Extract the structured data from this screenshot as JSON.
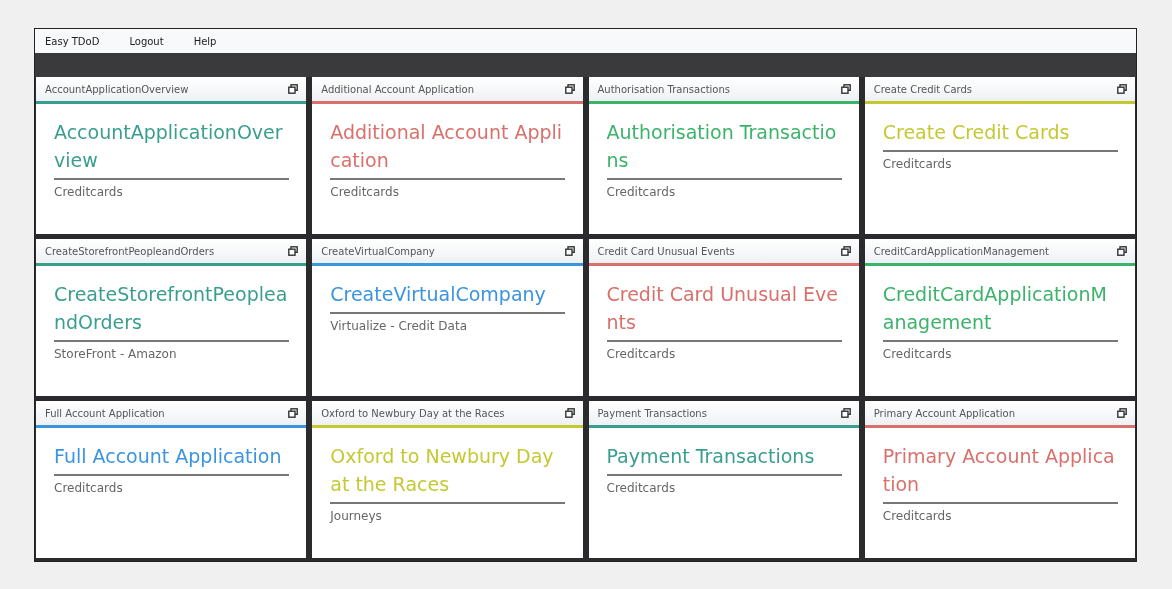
{
  "menu": [
    "Easy TDoD",
    "Logout",
    "Help"
  ],
  "cards": [
    {
      "header": "AccountApplicationOverview",
      "title": "AccountApplicationOverview",
      "subtitle": "Creditcards",
      "color": "#3a9e8f"
    },
    {
      "header": "Additional Account Application",
      "title": "Additional Account Application",
      "subtitle": "Creditcards",
      "color": "#d9706b"
    },
    {
      "header": "Authorisation Transactions",
      "title": "Authorisation Transactions",
      "subtitle": "Creditcards",
      "color": "#3bb36a"
    },
    {
      "header": "Create Credit Cards",
      "title": "Create Credit Cards",
      "subtitle": "Creditcards",
      "color": "#c5c832"
    },
    {
      "header": "CreateStorefrontPeopleandOrders",
      "title": "CreateStorefrontPeopleandOrders",
      "subtitle": "StoreFront - Amazon",
      "color": "#3a9e8f"
    },
    {
      "header": "CreateVirtualCompany",
      "title": "CreateVirtualCompany",
      "subtitle": "Virtualize - Credit Data",
      "color": "#3a94e0"
    },
    {
      "header": "Credit Card Unusual Events",
      "title": "Credit Card Unusual Events",
      "subtitle": "Creditcards",
      "color": "#d9706b"
    },
    {
      "header": "CreditCardApplicationManagement",
      "title": "CreditCardApplicationManagement",
      "subtitle": "Creditcards",
      "color": "#3bb36a"
    },
    {
      "header": "Full Account Application",
      "title": "Full Account Application",
      "subtitle": "Creditcards",
      "color": "#3a94e0"
    },
    {
      "header": "Oxford to Newbury Day at the Races",
      "title": "Oxford to Newbury Day at the Races",
      "subtitle": "Journeys",
      "color": "#c5c832"
    },
    {
      "header": "Payment Transactions",
      "title": "Payment Transactions",
      "subtitle": "Creditcards",
      "color": "#3a9e8f"
    },
    {
      "header": "Primary Account Application",
      "title": "Primary Account Application",
      "subtitle": "Creditcards",
      "color": "#d9706b"
    }
  ]
}
